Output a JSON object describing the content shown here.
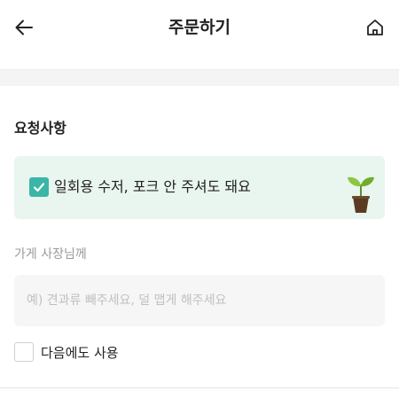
{
  "header": {
    "title": "주문하기"
  },
  "request": {
    "section_title": "요청사항",
    "eco_option": {
      "label": "일회용 수저, 포크 안 주셔도 돼요",
      "checked": true
    },
    "owner_label": "가게 사장님께",
    "owner_input": {
      "value": "",
      "placeholder": "예) 견과류 빼주세요, 덜 맵게 해주세요"
    },
    "reuse": {
      "label": "다음에도 사용",
      "checked": false
    }
  },
  "colors": {
    "accent": "#3bb5a6",
    "eco_bg": "#e9f5ef",
    "input_bg": "#f6f6f6"
  },
  "icons": {
    "back": "arrow-left-icon",
    "home": "home-icon",
    "check": "check-icon",
    "sprout": "sprout-icon"
  }
}
